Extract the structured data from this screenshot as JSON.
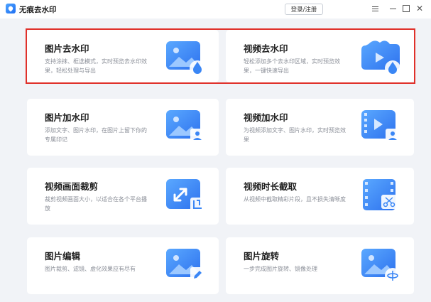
{
  "titlebar": {
    "app_title": "无痕去水印",
    "login_label": "登录/注册"
  },
  "cards": [
    {
      "title": "图片去水印",
      "desc": "支持涂抹、框选模式，实时预览去水印效果，轻松处理与导出",
      "icon": "image-droplet-icon"
    },
    {
      "title": "视频去水印",
      "desc": "轻松添加多个去水印区域，实时预览效果，一键快速导出",
      "icon": "video-droplet-icon"
    },
    {
      "title": "图片加水印",
      "desc": "添加文字、图片水印，在图片上留下你的专属印记",
      "icon": "image-stamp-icon"
    },
    {
      "title": "视频加水印",
      "desc": "为视频添加文字、图片水印，实时预览效果",
      "icon": "video-stamp-icon"
    },
    {
      "title": "视频画面裁剪",
      "desc": "裁剪视频画面大小，以适合在各个平台播放",
      "icon": "crop-icon"
    },
    {
      "title": "视频时长截取",
      "desc": "从视频中截取精彩片段，且不损失清晰度",
      "icon": "film-scissors-icon"
    },
    {
      "title": "图片编辑",
      "desc": "图片裁剪、滤镜、虚化效果应有尽有",
      "icon": "image-edit-icon"
    },
    {
      "title": "图片旋转",
      "desc": "一步完成图片旋转、镜像处理",
      "icon": "image-rotate-icon"
    }
  ],
  "colors": {
    "highlight": "#e0302a",
    "accent": "#3a86f5"
  }
}
